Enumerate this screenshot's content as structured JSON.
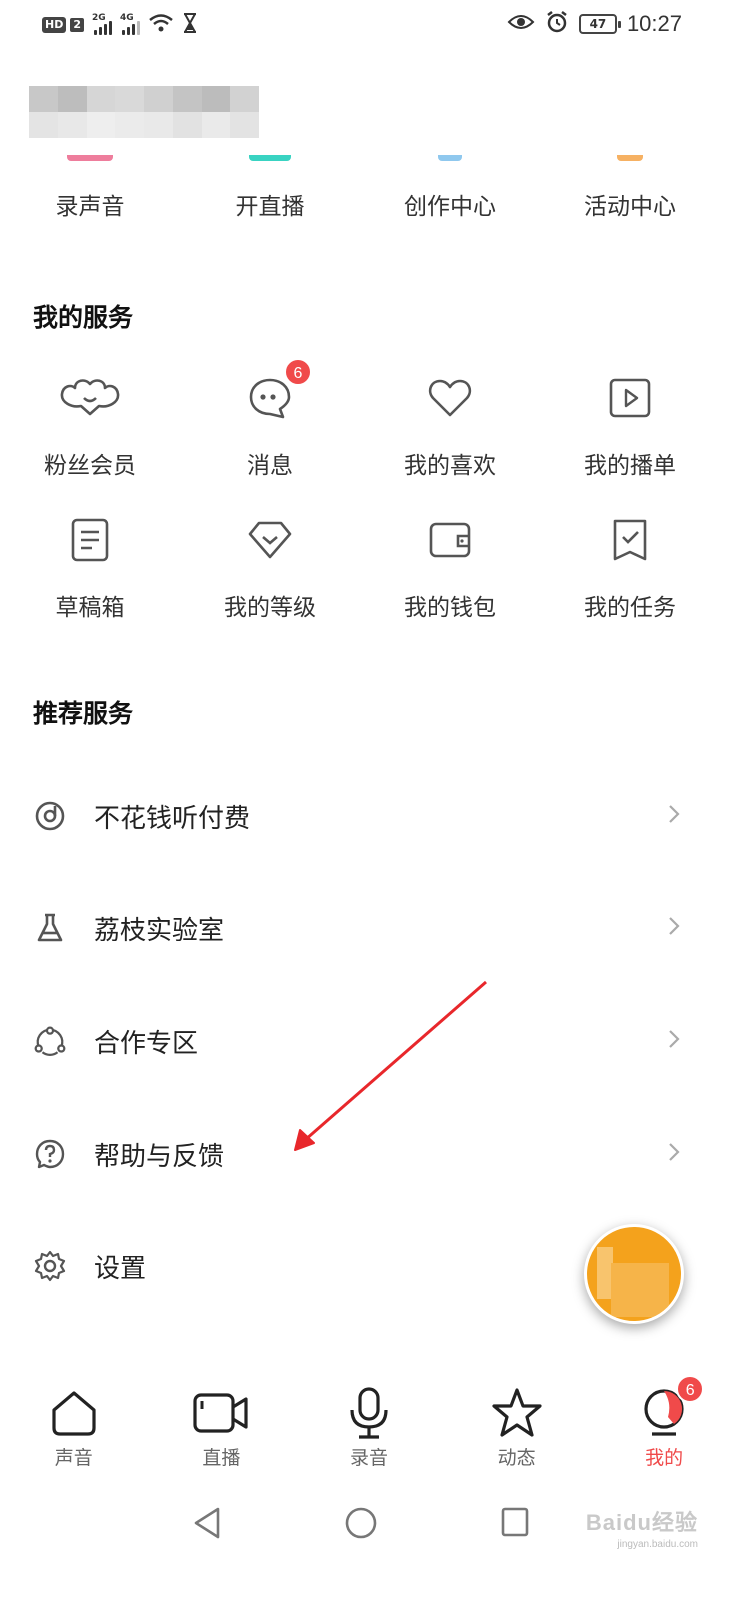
{
  "status_bar": {
    "hd": "HD",
    "sim": "2",
    "net1": "2G",
    "net2": "4G",
    "battery": "47",
    "time": "10:27"
  },
  "quick_actions": [
    {
      "label": "录声音",
      "color": "#ee7d9c"
    },
    {
      "label": "开直播",
      "color": "#39d3c2"
    },
    {
      "label": "创作中心",
      "color": "#8fc8ee"
    },
    {
      "label": "活动中心",
      "color": "#f6b163"
    }
  ],
  "my_services": {
    "title": "我的服务",
    "items": [
      {
        "label": "粉丝会员",
        "icon": "fan-member-icon"
      },
      {
        "label": "消息",
        "icon": "message-icon",
        "badge": "6"
      },
      {
        "label": "我的喜欢",
        "icon": "heart-icon"
      },
      {
        "label": "我的播单",
        "icon": "playlist-icon"
      },
      {
        "label": "草稿箱",
        "icon": "drafts-icon"
      },
      {
        "label": "我的等级",
        "icon": "level-icon"
      },
      {
        "label": "我的钱包",
        "icon": "wallet-icon"
      },
      {
        "label": "我的任务",
        "icon": "task-icon"
      }
    ]
  },
  "recommended": {
    "title": "推荐服务",
    "items": [
      {
        "label": "不花钱听付费",
        "icon": "disc-icon"
      },
      {
        "label": "荔枝实验室",
        "icon": "flask-icon"
      },
      {
        "label": "合作专区",
        "icon": "cooperation-icon"
      },
      {
        "label": "帮助与反馈",
        "icon": "help-icon"
      },
      {
        "label": "设置",
        "icon": "gear-icon"
      }
    ]
  },
  "tabs": [
    {
      "label": "声音",
      "icon": "home-icon"
    },
    {
      "label": "直播",
      "icon": "video-camera-icon"
    },
    {
      "label": "录音",
      "icon": "microphone-icon"
    },
    {
      "label": "动态",
      "icon": "star-icon"
    },
    {
      "label": "我的",
      "icon": "profile-icon",
      "badge": "6",
      "active": true
    }
  ],
  "watermark": {
    "text": "Baidu经验",
    "sub": "jingyan.baidu.com"
  },
  "colors": {
    "accent": "#f04a4a",
    "text": "#222222",
    "icon": "#555555"
  }
}
